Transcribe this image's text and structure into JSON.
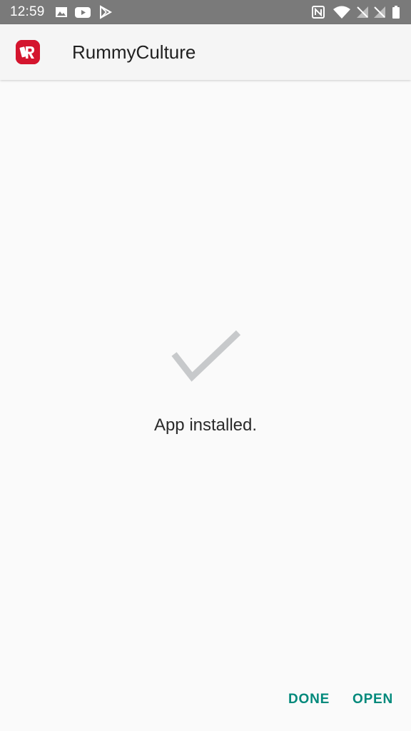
{
  "status_bar": {
    "time": "12:59",
    "notification_icons": [
      "image-icon",
      "youtube-icon",
      "play-store-icon"
    ],
    "system_icons": [
      "nfc-icon",
      "wifi-icon",
      "signal-icon",
      "signal-icon",
      "battery-icon"
    ]
  },
  "app_bar": {
    "title": "RummyCulture",
    "icon": "rummyculture-app-icon",
    "icon_color": "#d4152e"
  },
  "main": {
    "status_icon": "checkmark-icon",
    "message": "App installed."
  },
  "actions": {
    "done_label": "DONE",
    "open_label": "OPEN",
    "accent_color": "#00897b"
  }
}
